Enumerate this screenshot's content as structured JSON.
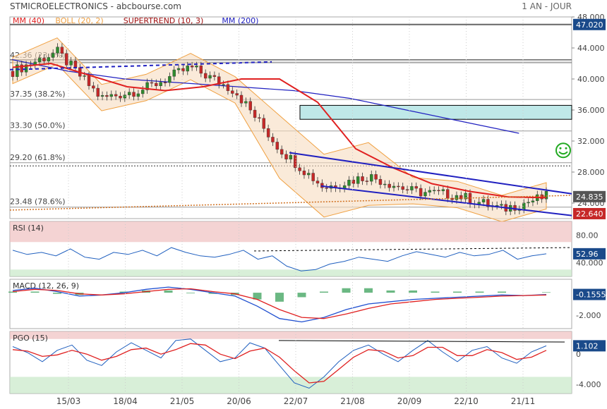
{
  "header": {
    "title": "STMICROELECTRONICS - abcbourse.com",
    "period": "1 AN - JOUR"
  },
  "colors": {
    "up": "#2e8b2e",
    "down": "#c62828",
    "mm40": "#e02020",
    "mm200": "#2020c0",
    "boll": "#f0a040",
    "supertrend": "#a01010",
    "pgo_signal": "#e02020",
    "rsi": "#1f5fbf",
    "macd_line": "#2050d0",
    "macd_signal": "#e02020",
    "hist": "#3aa05a",
    "overbought": "#f0c0c0",
    "oversold": "#c8e8c8",
    "zone": "#bfe8e8",
    "last_price_bg": "#555555",
    "stop_bg": "#c62828",
    "label_bg": "#1a4a8a"
  },
  "chart_data": [
    {
      "type": "candlestick",
      "title": "",
      "legend": [
        {
          "label": "MM (40)",
          "color": "#e02020"
        },
        {
          "label": "BOLL (20, 2)",
          "color": "#f0a040"
        },
        {
          "label": "SUPERTREND (10, 3)",
          "color": "#a01010"
        },
        {
          "label": "MM (200)",
          "color": "#2020c0"
        }
      ],
      "ylim": [
        22.0,
        48.0
      ],
      "yticks": [
        "48.000",
        "44.000",
        "40.000",
        "36.000",
        "32.000",
        "28.000",
        "24.000"
      ],
      "xticks": [
        "15/03",
        "18/04",
        "21/05",
        "20/06",
        "22/07",
        "21/08",
        "20/09",
        "22/10",
        "21/11"
      ],
      "fibonacci": [
        {
          "label": "42.36  (23.6%)",
          "value": 42.36
        },
        {
          "label": "37.35  (38.2%)",
          "value": 37.35
        },
        {
          "label": "33.30  (50.0%)",
          "value": 33.3
        },
        {
          "label": "29.20  (61.8%)",
          "value": 29.2
        },
        {
          "label": "23.48  (78.6%)",
          "value": 23.48
        }
      ],
      "horizontal_levels": [
        47.02,
        42.5,
        42.1,
        28.8
      ],
      "last_price": "24.835",
      "stop_level": "22.640",
      "top_level_label": "47.020",
      "key_points": [
        {
          "x": "15/03",
          "close": 41.0
        },
        {
          "x": "28/03",
          "close": 43.5
        },
        {
          "x": "18/04",
          "close": 37.5
        },
        {
          "x": "21/05",
          "close": 38.8
        },
        {
          "x": "20/06",
          "close": 41.5
        },
        {
          "x": "15/07",
          "close": 38.5
        },
        {
          "x": "22/07",
          "close": 31.0
        },
        {
          "x": "01/08",
          "close": 26.0
        },
        {
          "x": "21/08",
          "close": 27.5
        },
        {
          "x": "20/09",
          "close": 25.5
        },
        {
          "x": "22/10",
          "close": 25.0
        },
        {
          "x": "21/11",
          "close": 23.2
        },
        {
          "x": "last",
          "close": 24.835
        }
      ],
      "mm40_points": [
        41.5,
        42.0,
        40.5,
        39.0,
        38.5,
        39.0,
        40.0,
        40.0,
        37.0,
        31.0,
        28.5,
        26.5,
        25.5,
        24.8,
        24.7
      ],
      "mm200_points": [
        42.5,
        41.0,
        40.0,
        39.5,
        39.0,
        38.5,
        37.5,
        36.0,
        34.5,
        33.0
      ],
      "zones": [
        {
          "from": 34.8,
          "to": 36.6
        }
      ],
      "sentiment_icon": "smiley-icon"
    },
    {
      "type": "line",
      "title": "RSI (14)",
      "ylim": [
        20,
        100
      ],
      "yticks": [
        "80.00",
        "40.000"
      ],
      "overbought": 70,
      "oversold": 30,
      "last_value": "52.96",
      "points": [
        58,
        52,
        55,
        50,
        60,
        48,
        45,
        55,
        52,
        58,
        50,
        62,
        55,
        50,
        48,
        52,
        58,
        45,
        50,
        35,
        28,
        30,
        38,
        42,
        48,
        45,
        42,
        50,
        56,
        52,
        48,
        55,
        50,
        52,
        58,
        45,
        50,
        52.96
      ]
    },
    {
      "type": "line",
      "title": "MACD (12, 26, 9)",
      "ylim": [
        -3.2,
        1.2
      ],
      "yticks": [
        "-2.000"
      ],
      "last_value": "-0.1555",
      "macd_points": [
        0.2,
        0.4,
        0.1,
        -0.3,
        -0.2,
        0.0,
        0.3,
        0.5,
        0.3,
        0.0,
        -0.3,
        -1.2,
        -2.3,
        -2.6,
        -2.2,
        -1.5,
        -1.0,
        -0.8,
        -0.6,
        -0.5,
        -0.4,
        -0.3,
        -0.2,
        -0.25,
        -0.1555
      ],
      "signal_points": [
        0.1,
        0.3,
        0.2,
        -0.1,
        -0.2,
        -0.1,
        0.1,
        0.3,
        0.35,
        0.1,
        -0.1,
        -0.6,
        -1.5,
        -2.2,
        -2.3,
        -1.9,
        -1.4,
        -1.0,
        -0.8,
        -0.6,
        -0.5,
        -0.4,
        -0.3,
        -0.25,
        -0.2
      ]
    },
    {
      "type": "line",
      "title": "PGO (15)",
      "ylim": [
        -5.2,
        3.0
      ],
      "yticks": [
        "0",
        "-4.000"
      ],
      "last_value": "1.102",
      "points": [
        1.0,
        0.2,
        -1.0,
        0.5,
        1.2,
        -0.8,
        -1.5,
        0.3,
        1.5,
        0.5,
        -0.5,
        1.8,
        2.0,
        0.5,
        -1.0,
        -0.5,
        1.5,
        0.8,
        -1.5,
        -3.8,
        -4.5,
        -3.0,
        -1.0,
        0.5,
        1.2,
        0.0,
        -1.0,
        0.5,
        1.8,
        0.3,
        -1.0,
        0.5,
        1.0,
        -0.5,
        -1.2,
        0.3,
        1.102
      ],
      "signal_points": [
        0.6,
        0.4,
        -0.3,
        -0.1,
        0.5,
        0.0,
        -0.8,
        -0.3,
        0.6,
        0.8,
        0.0,
        0.6,
        1.4,
        1.2,
        0.0,
        -0.6,
        0.4,
        0.8,
        -0.4,
        -2.2,
        -3.8,
        -3.6,
        -2.0,
        -0.4,
        0.6,
        0.4,
        -0.5,
        -0.2,
        0.9,
        0.9,
        -0.2,
        -0.2,
        0.6,
        0.2,
        -0.7,
        -0.4,
        0.5
      ]
    }
  ]
}
